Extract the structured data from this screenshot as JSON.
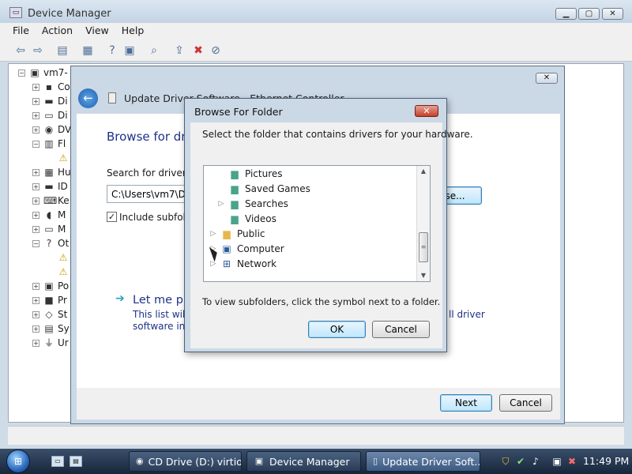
{
  "device_manager": {
    "title": "Device Manager",
    "menu": [
      "File",
      "Action",
      "View",
      "Help"
    ],
    "tree": {
      "root": "vm7-",
      "items": [
        "Co",
        "Di",
        "Di",
        "DV",
        "Fl",
        "",
        "Hu",
        "ID",
        "Ke",
        "M",
        "M",
        "Ot",
        "",
        "",
        "Po",
        "Pr",
        "St",
        "Sy",
        "Ur"
      ]
    }
  },
  "wizard": {
    "title": "Update Driver Software - Ethernet Controller",
    "heading": "Browse for dri",
    "search_label": "Search for driver so",
    "path_value": "C:\\Users\\vm7\\Do",
    "browse_button": "se...",
    "include_subfolders": "Include subfold",
    "let_me_pick": "Let me pi",
    "desc_line1_start": "This list will s",
    "desc_line1_end": "ll driver",
    "desc_line2": "software in t",
    "next_button": "Next",
    "cancel_button": "Cancel"
  },
  "browse_dialog": {
    "title": "Browse For Folder",
    "close": "✕",
    "instruction": "Select the folder that contains drivers for your hardware.",
    "items": [
      {
        "label": "Pictures",
        "expander": ""
      },
      {
        "label": "Saved Games",
        "expander": ""
      },
      {
        "label": "Searches",
        "expander": "▷"
      },
      {
        "label": "Videos",
        "expander": ""
      },
      {
        "label": "Public",
        "expander": "▷"
      },
      {
        "label": "Computer",
        "expander": "▷"
      },
      {
        "label": "Network",
        "expander": "▷"
      }
    ],
    "hint": "To view subfolders, click the symbol next to a folder.",
    "ok_button": "OK",
    "cancel_button": "Cancel"
  },
  "taskbar": {
    "tasks": [
      {
        "label": "CD Drive (D:) virtio..."
      },
      {
        "label": "Device Manager"
      },
      {
        "label": "Update Driver Soft..."
      }
    ],
    "clock": "11:49 PM"
  }
}
